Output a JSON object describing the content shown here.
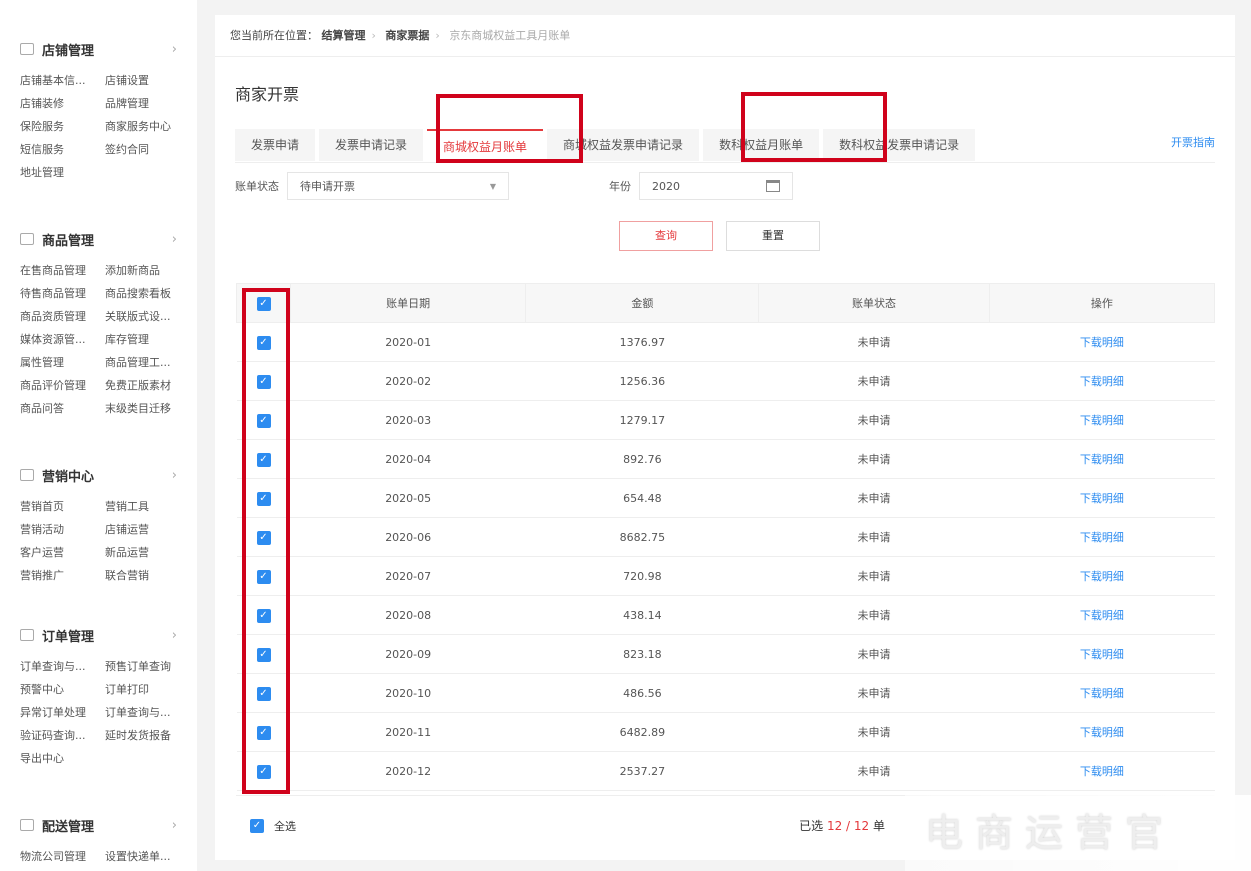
{
  "sidebar": [
    {
      "title": "店铺管理",
      "items": [
        "店铺基本信...",
        "店铺设置",
        "店铺装修",
        "品牌管理",
        "保险服务",
        "商家服务中心",
        "短信服务",
        "签约合同",
        "地址管理"
      ]
    },
    {
      "title": "商品管理",
      "items": [
        "在售商品管理",
        "添加新商品",
        "待售商品管理",
        "商品搜索看板",
        "商品资质管理",
        "关联版式设...",
        "媒体资源管...",
        "库存管理",
        "属性管理",
        "商品管理工...",
        "商品评价管理",
        "免费正版素材",
        "商品问答",
        "末级类目迁移"
      ]
    },
    {
      "title": "营销中心",
      "items": [
        "营销首页",
        "营销工具",
        "营销活动",
        "店铺运营",
        "客户运营",
        "新品运营",
        "营销推广",
        "联合营销"
      ]
    },
    {
      "title": "订单管理",
      "items": [
        "订单查询与...",
        "预售订单查询",
        "预警中心",
        "订单打印",
        "异常订单处理",
        "订单查询与...",
        "验证码查询...",
        "延时发货报备",
        "导出中心"
      ]
    },
    {
      "title": "配送管理",
      "items": [
        "物流公司管理",
        "设置快递单..."
      ]
    }
  ],
  "breadcrumb": {
    "prefix": "您当前所在位置：",
    "items": [
      "结算管理",
      "商家票据"
    ],
    "current": "京东商城权益工具月账单"
  },
  "page_title": "商家开票",
  "tabs": [
    "发票申请",
    "发票申请记录",
    "商城权益月账单",
    "商城权益发票申请记录",
    "数科权益月账单",
    "数科权益发票申请记录"
  ],
  "active_tab": 2,
  "guide_link": "开票指南",
  "filter": {
    "status_label": "账单状态",
    "status_value": "待申请开票",
    "year_label": "年份",
    "year_value": "2020"
  },
  "buttons": {
    "query": "查询",
    "reset": "重置"
  },
  "table": {
    "headers": [
      "账单日期",
      "金额",
      "账单状态",
      "操作"
    ],
    "rows": [
      [
        "2020-01",
        "1376.97",
        "未申请",
        "下载明细"
      ],
      [
        "2020-02",
        "1256.36",
        "未申请",
        "下载明细"
      ],
      [
        "2020-03",
        "1279.17",
        "未申请",
        "下载明细"
      ],
      [
        "2020-04",
        "892.76",
        "未申请",
        "下载明细"
      ],
      [
        "2020-05",
        "654.48",
        "未申请",
        "下载明细"
      ],
      [
        "2020-06",
        "8682.75",
        "未申请",
        "下载明细"
      ],
      [
        "2020-07",
        "720.98",
        "未申请",
        "下载明细"
      ],
      [
        "2020-08",
        "438.14",
        "未申请",
        "下载明细"
      ],
      [
        "2020-09",
        "823.18",
        "未申请",
        "下载明细"
      ],
      [
        "2020-10",
        "486.56",
        "未申请",
        "下载明细"
      ],
      [
        "2020-11",
        "6482.89",
        "未申请",
        "下载明细"
      ],
      [
        "2020-12",
        "2537.27",
        "未申请",
        "下载明细"
      ]
    ]
  },
  "footer": {
    "select_all": "全选",
    "selected_prefix": "已选",
    "selected": "12 / 12",
    "selected_suffix": "单"
  },
  "watermark": "电商运营官",
  "colors": {
    "accent": "#e4393c",
    "link": "#2d8cf0",
    "highlight": "#d0021b"
  }
}
